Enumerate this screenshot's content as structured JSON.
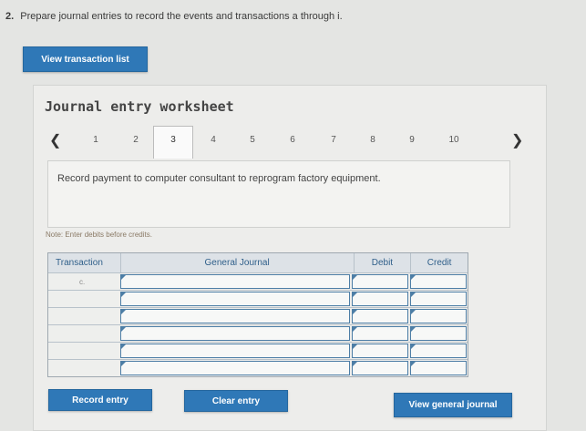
{
  "question": {
    "number": "2.",
    "text": "Prepare journal entries to record the events and transactions a through i."
  },
  "buttons": {
    "view_transaction_list": "View transaction list",
    "record_entry": "Record entry",
    "clear_entry": "Clear entry",
    "view_general_journal": "View general journal"
  },
  "worksheet": {
    "title": "Journal entry worksheet",
    "pages": [
      "1",
      "2",
      "3",
      "4",
      "5",
      "6",
      "7",
      "8",
      "9",
      "10"
    ],
    "active_page": "3",
    "prev_icon": "chevron-left-icon",
    "next_icon": "chevron-right-icon",
    "description": "Record payment to computer consultant to reprogram factory equipment.",
    "note": "Note: Enter debits before credits."
  },
  "table": {
    "headers": {
      "transaction": "Transaction",
      "general_journal": "General Journal",
      "debit": "Debit",
      "credit": "Credit"
    },
    "rows": [
      {
        "transaction": "c.",
        "account": "",
        "debit": "",
        "credit": ""
      },
      {
        "transaction": "",
        "account": "",
        "debit": "",
        "credit": ""
      },
      {
        "transaction": "",
        "account": "",
        "debit": "",
        "credit": ""
      },
      {
        "transaction": "",
        "account": "",
        "debit": "",
        "credit": ""
      },
      {
        "transaction": "",
        "account": "",
        "debit": "",
        "credit": ""
      },
      {
        "transaction": "",
        "account": "",
        "debit": "",
        "credit": ""
      }
    ]
  },
  "colors": {
    "accent": "#2f78b7",
    "background": "#e4e5e3"
  }
}
